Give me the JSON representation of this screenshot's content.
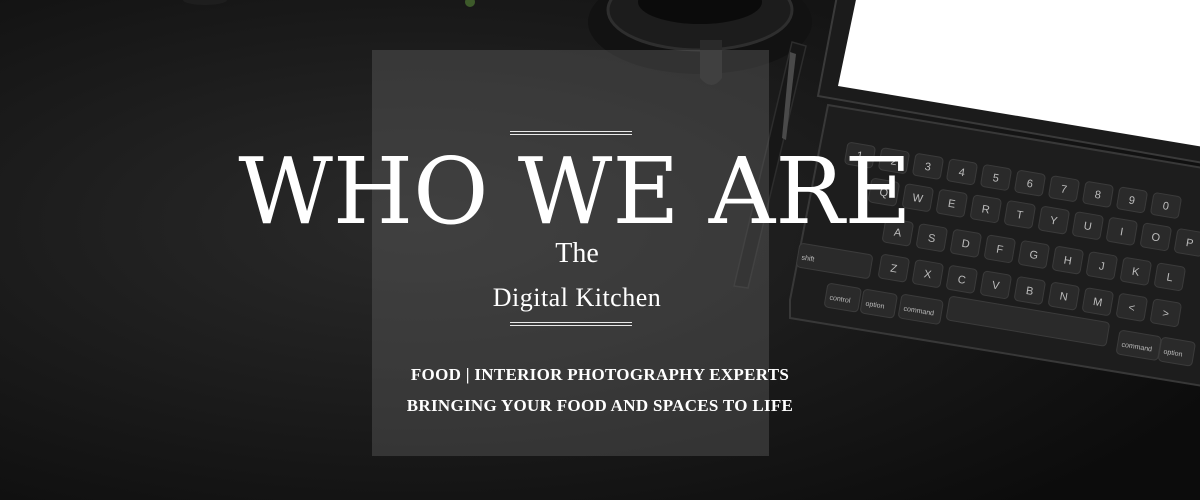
{
  "hero": {
    "headline": "WHO WE ARE",
    "subtitle_line1": "The",
    "subtitle_line2": "Digital Kitchen",
    "tagline_line1": "FOOD | INTERIOR PHOTOGRAPHY EXPERTS",
    "tagline_line2": "BRINGING YOUR FOOD AND SPACES TO LIFE"
  },
  "keyboard": {
    "row_numbers": [
      "!\n1",
      "@\n2",
      "#\n3",
      "$\n4",
      "%\n5",
      "^\n6",
      "&\n7",
      "*\n8",
      "(\n9",
      ")\n0"
    ],
    "row_top": [
      "Q",
      "W",
      "E",
      "R",
      "T",
      "Y",
      "U",
      "I",
      "O",
      "P"
    ],
    "row_home": [
      "A",
      "S",
      "D",
      "F",
      "G",
      "H",
      "J",
      "K",
      "L"
    ],
    "row_bottom": [
      "Z",
      "X",
      "C",
      "V",
      "B",
      "N",
      "M",
      "<",
      ">"
    ],
    "modifiers": [
      "shift",
      "control",
      "option",
      "command",
      "command",
      "option"
    ]
  },
  "colors": {
    "background": "#141414",
    "panel": "#5f5f5f",
    "text": "#ffffff",
    "tablet_screen": "#ffffff"
  }
}
